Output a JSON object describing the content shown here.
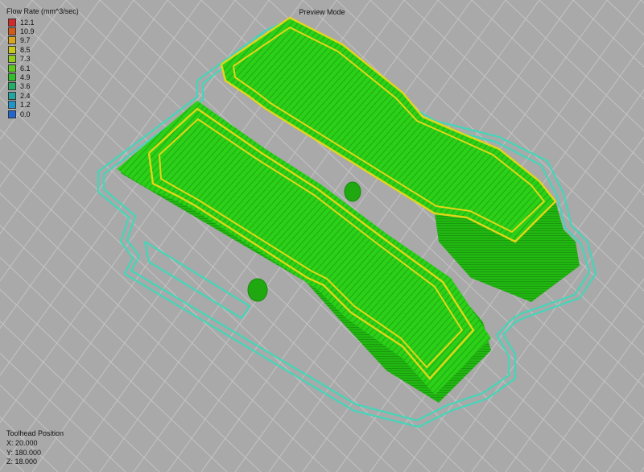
{
  "viewport": {
    "mode_label": "Preview Mode",
    "bed_color": "#a9a9a9",
    "grid_color": "#c4c4c4",
    "model_color": "#28c814",
    "perimeter_color": "#e3d617",
    "skirt_color": "#43d6b8"
  },
  "legend": {
    "title": "Flow Rate (mm^3/sec)",
    "entries": [
      {
        "value": "12.1",
        "color": "#d42a2a"
      },
      {
        "value": "10.9",
        "color": "#d45a18"
      },
      {
        "value": "9.7",
        "color": "#d9a51a"
      },
      {
        "value": "8.5",
        "color": "#c8c81a"
      },
      {
        "value": "7.3",
        "color": "#92cc1a"
      },
      {
        "value": "6.1",
        "color": "#5cc81a"
      },
      {
        "value": "4.9",
        "color": "#2ebf2a"
      },
      {
        "value": "3.6",
        "color": "#22ae66"
      },
      {
        "value": "2.4",
        "color": "#20a8a0"
      },
      {
        "value": "1.2",
        "color": "#2096c8"
      },
      {
        "value": "0.0",
        "color": "#2264d0"
      }
    ]
  },
  "toolhead": {
    "title": "Toolhead Position",
    "x": "X: 20.000",
    "y": "Y: 180.000",
    "z": "Z: 18.000"
  }
}
